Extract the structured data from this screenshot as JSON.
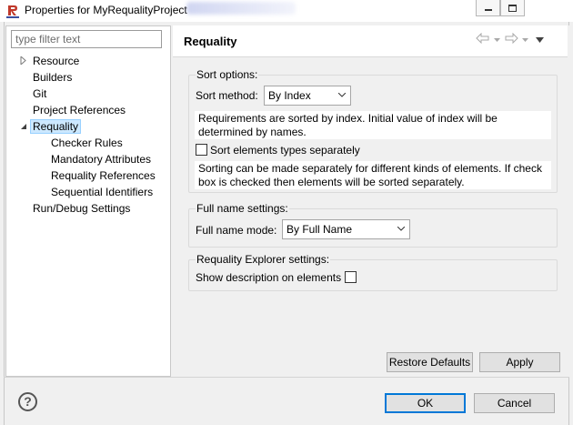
{
  "window": {
    "title": "Properties for MyRequalityProject",
    "logo_text": "Requality"
  },
  "filter": {
    "placeholder": "type filter text"
  },
  "tree": [
    {
      "label": "Resource",
      "expander": "collapsed"
    },
    {
      "label": "Builders"
    },
    {
      "label": "Git"
    },
    {
      "label": "Project References"
    },
    {
      "label": "Requality",
      "expander": "expanded",
      "selected": true
    },
    {
      "label": "Checker Rules"
    },
    {
      "label": "Mandatory Attributes"
    },
    {
      "label": "Requality References"
    },
    {
      "label": "Sequential Identifiers"
    },
    {
      "label": "Run/Debug Settings"
    }
  ],
  "page": {
    "title": "Requality"
  },
  "sort_options": {
    "group_title": "Sort options:",
    "method_label": "Sort method:",
    "method_value": "By Index",
    "method_description": "Requirements are sorted by index. Initial value of index will be determined by names.",
    "separate_label": "Sort elements types separately",
    "separate_checked": false,
    "separate_description": "Sorting can be made separately for different kinds of elements. If check box is checked then elements will be sorted separately."
  },
  "full_name": {
    "group_title": "Full name settings:",
    "mode_label": "Full name mode:",
    "mode_value": "By Full Name"
  },
  "explorer": {
    "group_title": "Requality Explorer settings:",
    "show_desc_label": "Show description on elements",
    "show_desc_checked": false
  },
  "buttons": {
    "restore_defaults": "Restore Defaults",
    "apply": "Apply",
    "ok": "OK",
    "cancel": "Cancel"
  },
  "icons": {
    "help": "?",
    "focus_color": "#0078d7",
    "selection_color": "#cce8ff"
  }
}
